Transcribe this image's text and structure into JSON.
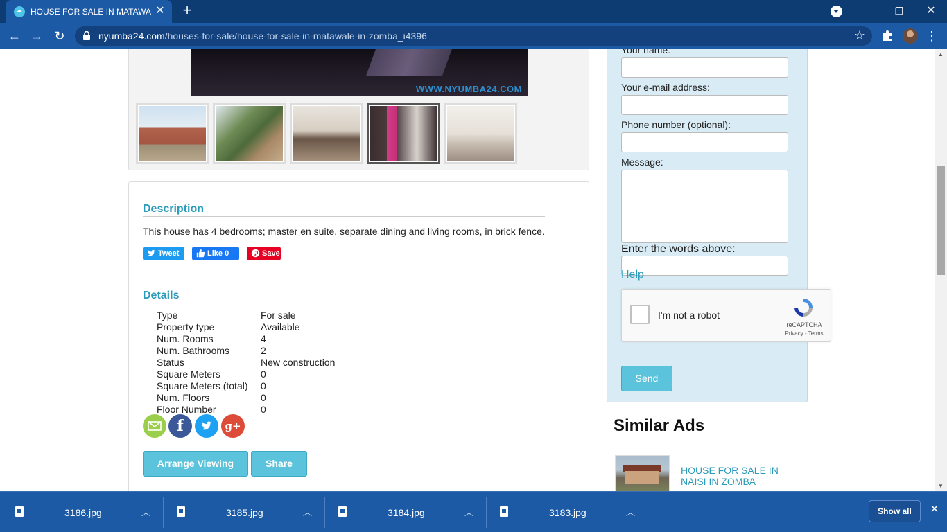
{
  "browser": {
    "tab_title": "HOUSE FOR SALE IN MATAWALE",
    "url_domain": "nyumba24.com",
    "url_path": "/houses-for-sale/house-for-sale-in-matawale-in-zomba_i4396"
  },
  "gallery": {
    "watermark": "WWW.NYUMBA24.COM",
    "thumbnails": [
      {
        "name": "exterior-front",
        "active": false
      },
      {
        "name": "exterior-side",
        "active": false
      },
      {
        "name": "living-room",
        "active": false
      },
      {
        "name": "bedroom",
        "active": true
      },
      {
        "name": "bathroom",
        "active": false
      }
    ]
  },
  "description": {
    "heading": "Description",
    "text": "This house has 4 bedrooms; master en suite, separate dining and living rooms, in brick fence.",
    "tweet_label": "Tweet",
    "like_label": "Like 0",
    "save_label": "Save"
  },
  "details": {
    "heading": "Details",
    "rows": [
      {
        "key": "Type",
        "value": "For sale"
      },
      {
        "key": "Property type",
        "value": "Available"
      },
      {
        "key": "Num. Rooms",
        "value": "4"
      },
      {
        "key": "Num. Bathrooms",
        "value": "2"
      },
      {
        "key": "Status",
        "value": "New construction"
      },
      {
        "key": "Square Meters",
        "value": "0"
      },
      {
        "key": "Square Meters (total)",
        "value": "0"
      },
      {
        "key": "Num. Floors",
        "value": "0"
      },
      {
        "key": "Floor Number",
        "value": "0"
      }
    ],
    "arrange_viewing_label": "Arrange Viewing",
    "share_label": "Share",
    "google_plus_glyph": "g+"
  },
  "contact": {
    "name_label": "Your name:",
    "email_label": "Your e-mail address:",
    "phone_label": "Phone number (optional):",
    "message_label": "Message:",
    "words_label": "Enter the words above:",
    "help_label": "Help",
    "captcha_label": "I'm not a robot",
    "captcha_brand": "reCAPTCHA",
    "captcha_terms": "Privacy - Terms",
    "send_label": "Send"
  },
  "similar": {
    "heading": "Similar Ads",
    "items": [
      {
        "title": "HOUSE FOR SALE IN NAISI IN ZOMBA"
      }
    ]
  },
  "downloads": {
    "items": [
      {
        "name": "3186.jpg"
      },
      {
        "name": "3185.jpg"
      },
      {
        "name": "3184.jpg"
      },
      {
        "name": "3183.jpg"
      }
    ],
    "show_all_label": "Show all"
  },
  "colors": {
    "accent": "#2a9bb9",
    "button": "#5bc3db",
    "chrome": "#1c5aa6"
  }
}
